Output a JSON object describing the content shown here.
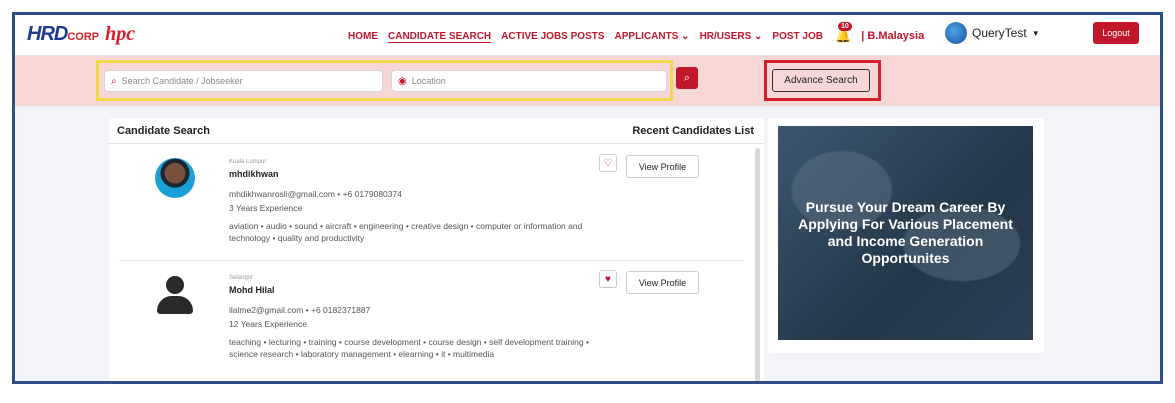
{
  "brand": {
    "logo_primary": "HRD",
    "logo_primary_suffix": "CORP",
    "logo_secondary": "hpc"
  },
  "nav": {
    "items": [
      {
        "label": "HOME"
      },
      {
        "label": "CANDIDATE SEARCH"
      },
      {
        "label": "ACTIVE JOBS POSTS"
      },
      {
        "label": "APPLICANTS ⌄"
      },
      {
        "label": "HR/USERS ⌄"
      },
      {
        "label": "POST JOB"
      }
    ],
    "notification_count": "10",
    "country": "| B.Malaysia",
    "user_name": "QueryTest",
    "logout_label": "Logout",
    "accent_color": "#c0172a"
  },
  "search": {
    "candidate_placeholder": "Search Candidate / Jobseeker",
    "location_placeholder": "Location",
    "advance_label": "Advance Search"
  },
  "panel": {
    "title": "Candidate Search",
    "recent_label": "Recent Candidates List",
    "candidates": [
      {
        "city": "Kuala Lumpur",
        "name": "mhdikhwan",
        "contact": "mhdikhwanrosli@gmail.com • +6 0179080374",
        "experience": "3 Years Experience",
        "skills": "aviation • audio • sound • aircraft • engineering • creative design • computer or information and technology • quality and productivity",
        "favorite": false,
        "view_label": "View Profile"
      },
      {
        "city": "Selangor",
        "name": "Mohd Hilal",
        "contact": "ilalme2@gmail.com • +6 0182371887",
        "experience": "12 Years Experience",
        "skills": "teaching • lecturing • training • course development • course design • self development training • science research • laboratory management • elearning • it • multimedia",
        "favorite": true,
        "view_label": "View Profile"
      }
    ]
  },
  "promo": {
    "text": "Pursue Your Dream Career By Applying For Various Placement and Income Generation Opportunites"
  }
}
